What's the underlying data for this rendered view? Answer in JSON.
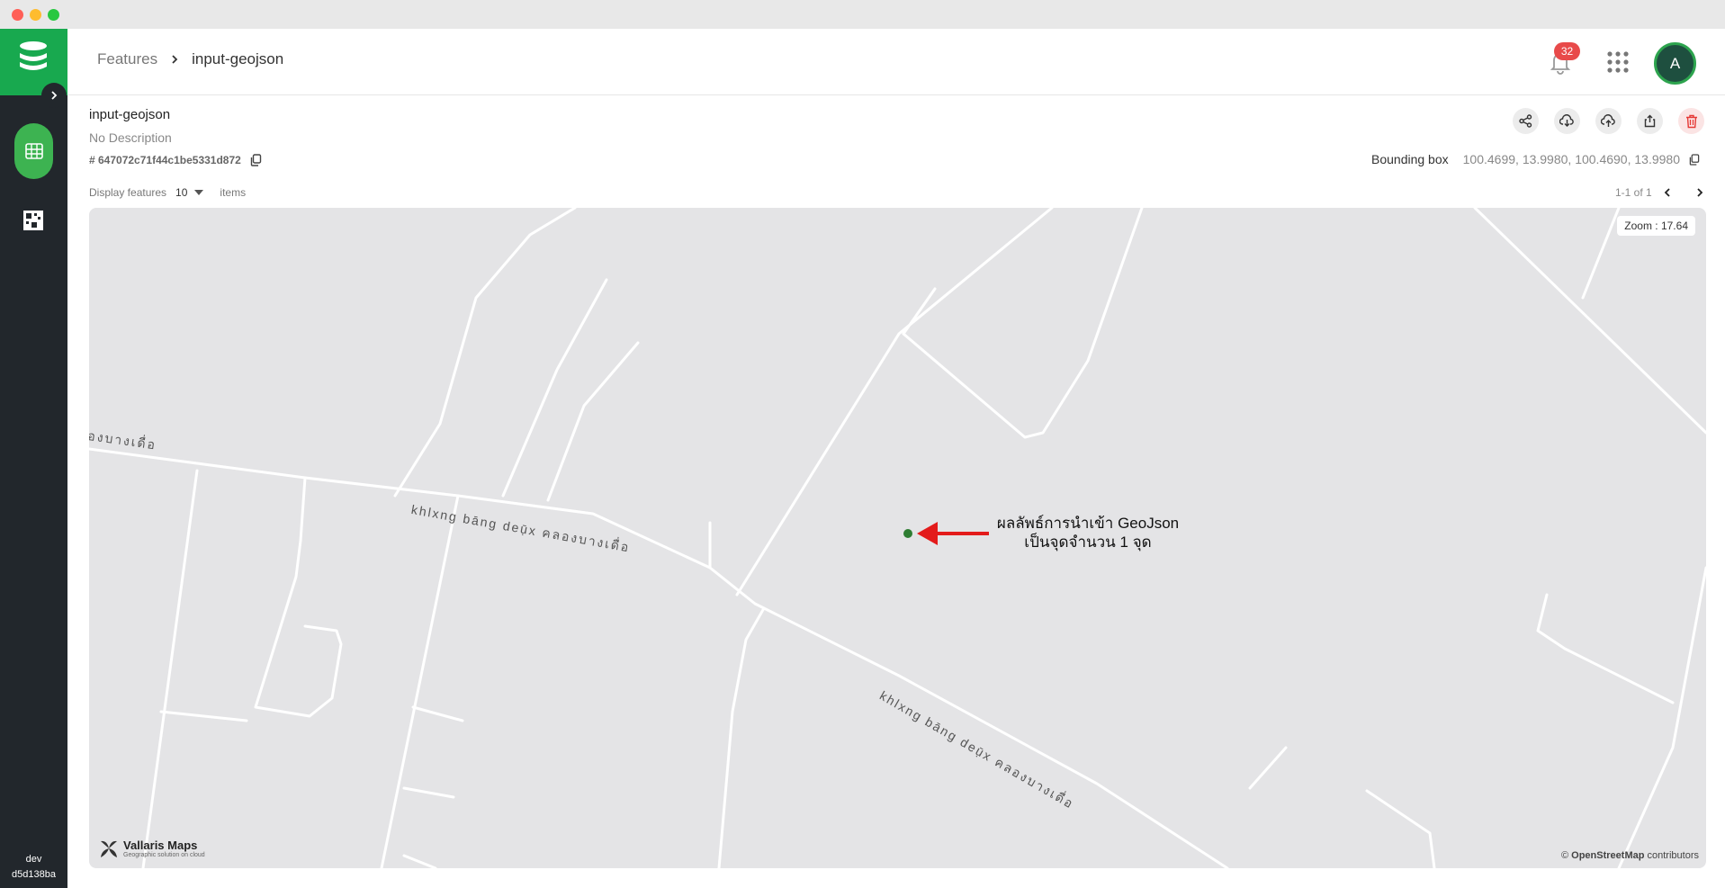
{
  "breadcrumb": {
    "root": "Features",
    "current": "input-geojson"
  },
  "notifications": {
    "count": "32"
  },
  "user": {
    "initial": "A"
  },
  "sidebar": {
    "env": "dev",
    "build": "d5d138ba"
  },
  "layer": {
    "title": "input-geojson",
    "description": "No Description",
    "id": "# 647072c71f44c1be5331d872",
    "bbox_label": "Bounding box",
    "bbox_value": "100.4699, 13.9980, 100.4690, 13.9980"
  },
  "display": {
    "label": "Display features",
    "count": "10",
    "unit": "items"
  },
  "pager": {
    "range": "1-1 of 1"
  },
  "map": {
    "zoom": "Zoom : 17.64",
    "annotation_line1": "ผลลัพธ์การนำเข้า GeoJson",
    "annotation_line2": "เป็นจุดจำนวน 1 จุด",
    "road_label_1": "khlxng bāng deụ̄x คลองบางเดื่อ",
    "road_label_2": "khlxng bāng deụ̄x คลองบางเดื่อ",
    "road_label_3": "องบางเดื่อ",
    "brand": "Vallaris Maps",
    "brand_tag": "Geographic solution on cloud",
    "credit_prefix": "©",
    "credit_osm": "OpenStreetMap",
    "credit_suffix": "contributors"
  },
  "colors": {
    "brand_green": "#18a94f",
    "sidebar": "#22272c",
    "point": "#2e7d32",
    "arrow": "#e31b1b"
  },
  "icons": [
    "logo-icon",
    "chevron-right-icon",
    "table-icon",
    "grid-icon",
    "bell-icon",
    "apps-icon",
    "share-icon",
    "cloud-download-icon",
    "cloud-upload-icon",
    "export-icon",
    "trash-icon",
    "copy-icon",
    "chevron-left-icon",
    "caret-down-icon"
  ]
}
